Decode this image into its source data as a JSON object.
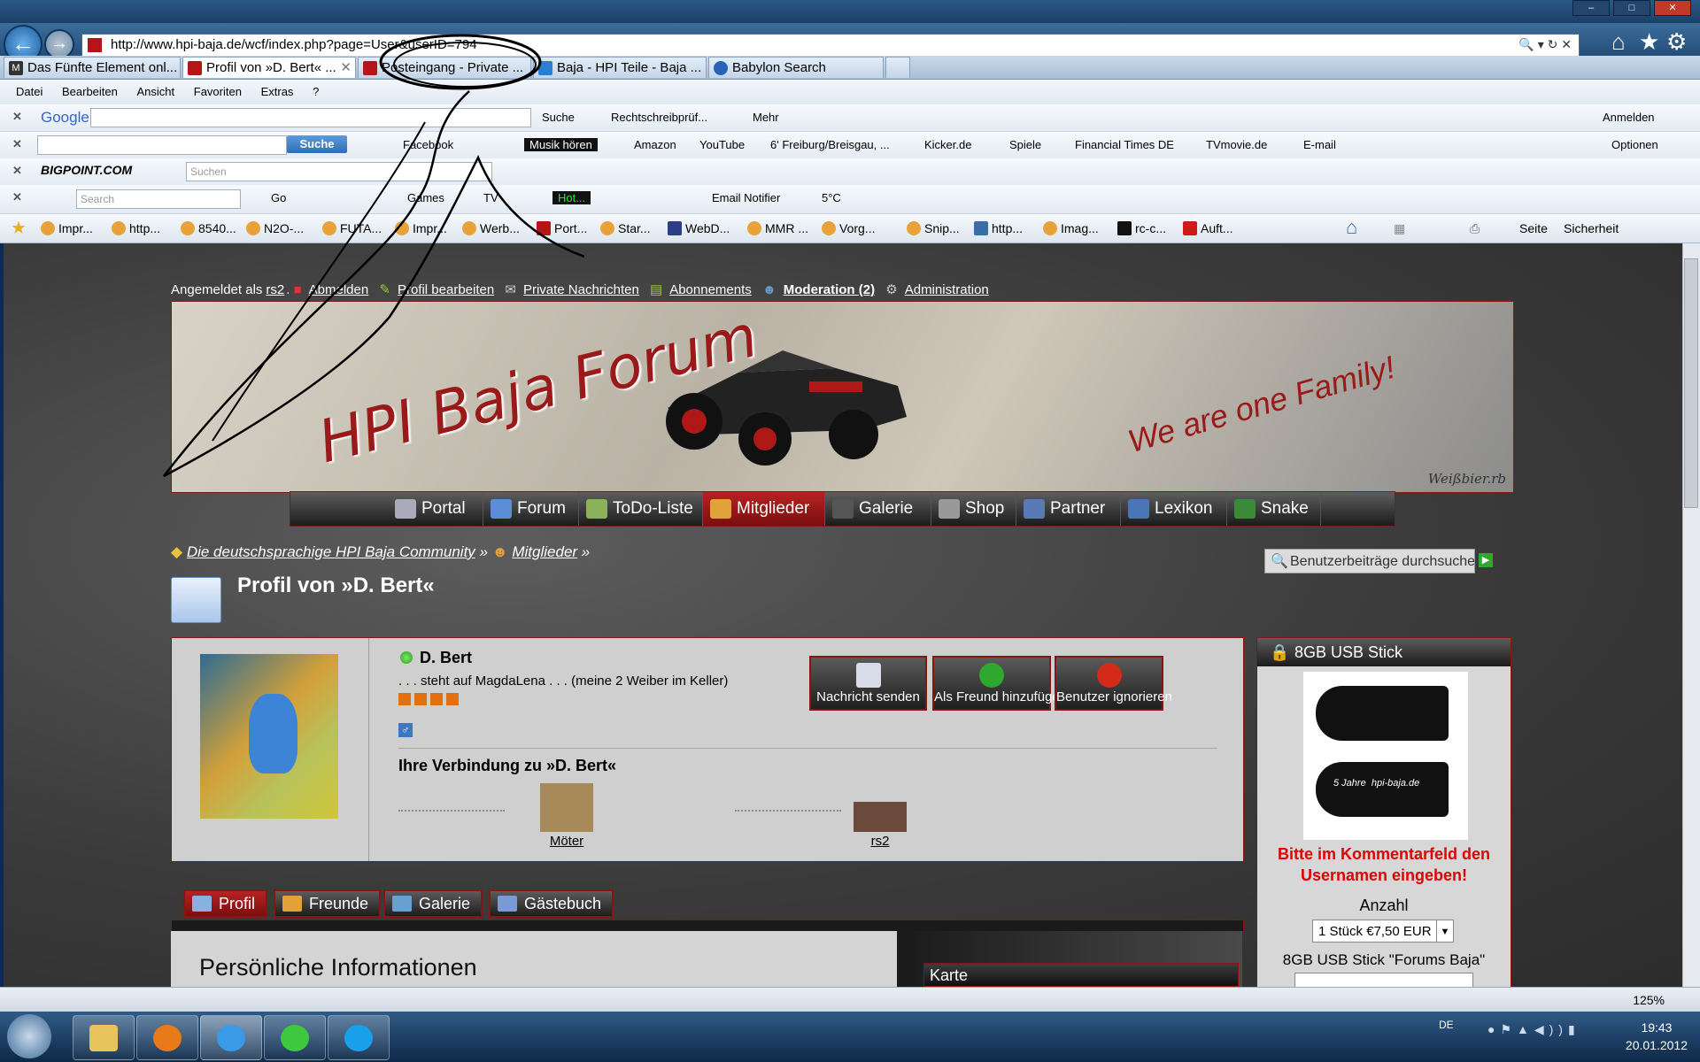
{
  "browser": {
    "url": "http://www.hpi-baja.de/wcf/index.php?page=User&userID=794",
    "tabs": [
      {
        "label": "Das Fünfte Element onl...",
        "active": false
      },
      {
        "label": "Profil von »D. Bert« ...",
        "active": true
      },
      {
        "label": "Posteingang - Private ...",
        "active": false
      },
      {
        "label": "Baja - HPI Teile - Baja ...",
        "active": false
      },
      {
        "label": "Babylon Search",
        "active": false
      }
    ],
    "menu": [
      "Datei",
      "Bearbeiten",
      "Ansicht",
      "Favoriten",
      "Extras",
      "?"
    ]
  },
  "google_toolbar": {
    "logo": "Google",
    "search": "Suche",
    "spell": "Rechtschreibprüf...",
    "more": "Mehr",
    "signin": "Anmelden"
  },
  "ask_toolbar": {
    "button": "Suche",
    "items": [
      "Facebook",
      "Musik hören",
      "Amazon",
      "YouTube",
      "6' Freiburg/Breisgau, ...",
      "Kicker.de",
      "Spiele",
      "Financial Times DE",
      "TVmovie.de",
      "E-mail"
    ],
    "options": "Optionen"
  },
  "bigpoint_toolbar": {
    "logo": "BIGPOINT.COM",
    "placeholder": "Suchen"
  },
  "fourth_toolbar": {
    "placeholder": "Search",
    "go": "Go",
    "games": "Games",
    "tv": "TV",
    "hot": "Hot...",
    "email": "Email Notifier",
    "temp": "5°C"
  },
  "favorites": [
    "Impr...",
    "http...",
    "8540...",
    "N2O-...",
    "FUTA...",
    "Impr...",
    "Werb...",
    "Port...",
    "Star...",
    "WebD...",
    "MMR ...",
    "Vorg...",
    "Snip...",
    "http...",
    "Imag...",
    "rc-c...",
    "Auft..."
  ],
  "fav_right": {
    "page": "Seite",
    "security": "Sicherheit"
  },
  "forum": {
    "userbar": {
      "prefix": "Angemeldet als",
      "user": "rs2",
      "logout": "Abmelden",
      "edit": "Profil bearbeiten",
      "pm": "Private Nachrichten",
      "subs": "Abonnements",
      "mod": "Moderation (2)",
      "admin": "Administration"
    },
    "banner": {
      "title": "HPI Baja Forum",
      "slogan": "We are one Family!",
      "signature": "Weißbier.rb"
    },
    "nav": [
      "Portal",
      "Forum",
      "ToDo-Liste",
      "Mitglieder",
      "Galerie",
      "Shop",
      "Partner",
      "Lexikon",
      "Snake"
    ],
    "nav_active": "Mitglieder",
    "breadcrumb": {
      "root": "Die deutschsprachige HPI Baja Community",
      "sep": "»",
      "members": "Mitglieder"
    },
    "search_button": "Benutzerbeiträge durchsuchen",
    "page_title": "Profil von »D. Bert«",
    "profile": {
      "name": "D. Bert",
      "title": ". . . steht auf MagdaLena . . . (meine 2 Weiber im Keller)",
      "gender": "♂",
      "connection_title": "Ihre Verbindung zu »D. Bert«",
      "connections": [
        "Möter",
        "rs2"
      ],
      "actions": [
        "Nachricht senden",
        "Als Freund hinzufügen",
        "Benutzer ignorieren"
      ]
    },
    "tabs": [
      "Profil",
      "Freunde",
      "Galerie",
      "Gästebuch"
    ],
    "section_title": "Persönliche Informationen",
    "map_title": "Karte",
    "sidebox": {
      "title": "8GB USB Stick",
      "usb_label": "hpi-baja.de",
      "usb_label2": "5 Jahre",
      "note": "Bitte im Kommentarfeld den Usernamen eingeben!",
      "qty_label": "Anzahl",
      "qty_value": "1 Stück €7,50 EUR",
      "product": "8GB USB Stick \"Forums Baja\""
    }
  },
  "status": {
    "zoom": "125%"
  },
  "taskbar": {
    "lang": "DE",
    "time": "19:43",
    "date": "20.01.2012"
  }
}
